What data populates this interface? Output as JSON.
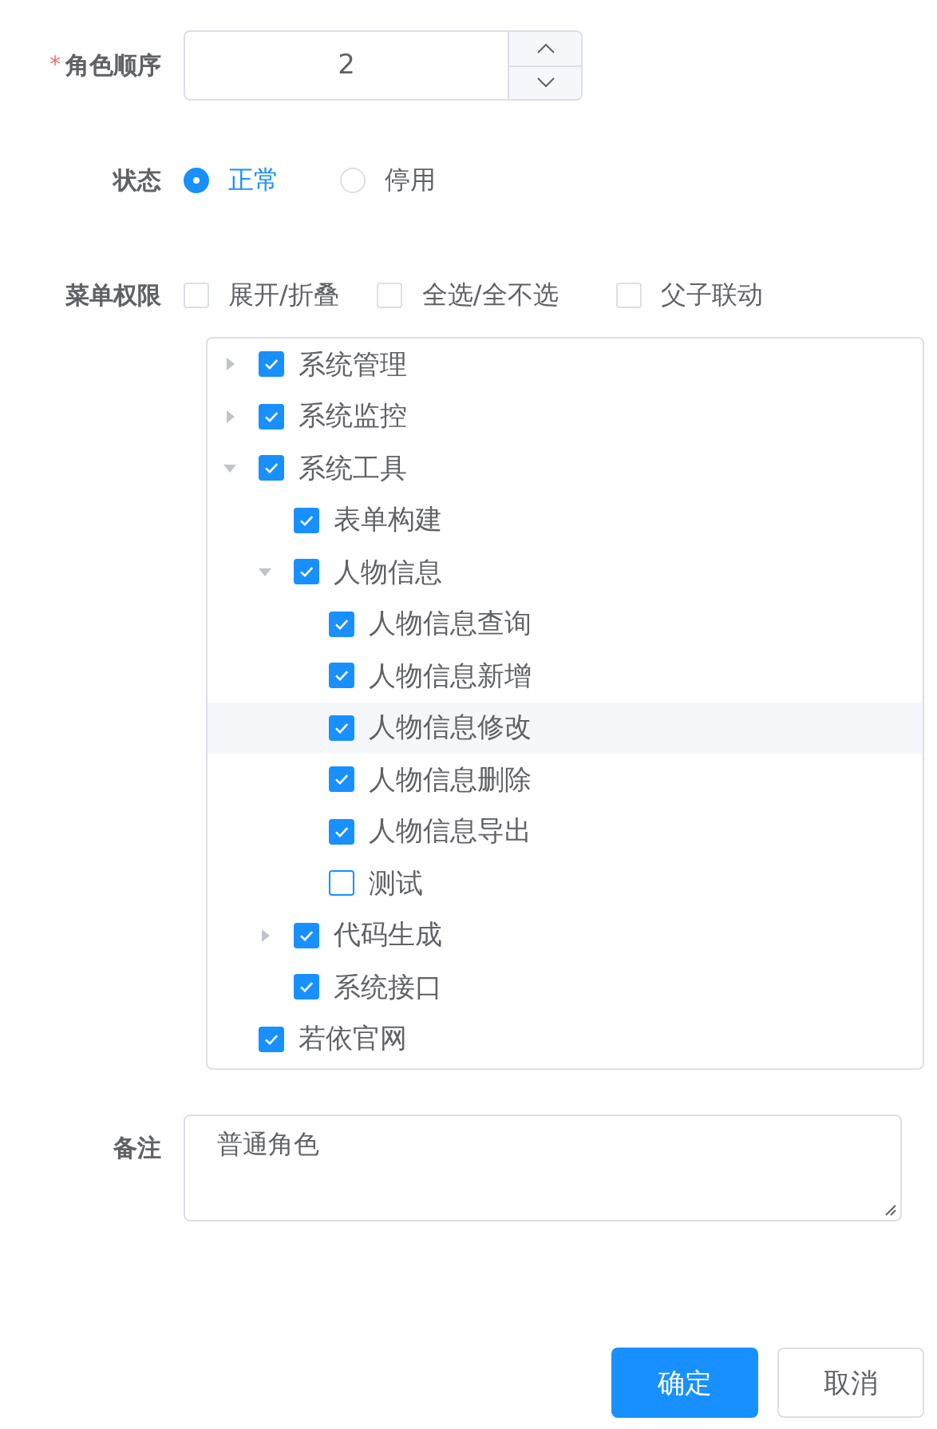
{
  "order": {
    "label": "角色顺序",
    "required_mark": "*",
    "value": "2"
  },
  "status": {
    "label": "状态",
    "options": [
      {
        "label": "正常",
        "selected": true
      },
      {
        "label": "停用",
        "selected": false
      }
    ]
  },
  "menu_permissions": {
    "label": "菜单权限",
    "options": [
      {
        "label": "展开/折叠",
        "checked": false
      },
      {
        "label": "全选/全不选",
        "checked": false
      },
      {
        "label": "父子联动",
        "checked": false
      }
    ],
    "tree": [
      {
        "label": "系统管理",
        "checked": true,
        "expanded": false,
        "hovered": false
      },
      {
        "label": "系统监控",
        "checked": true,
        "expanded": false,
        "hovered": false
      },
      {
        "label": "系统工具",
        "checked": true,
        "expanded": true,
        "hovered": false,
        "children": [
          {
            "label": "表单构建",
            "checked": true,
            "hovered": false
          },
          {
            "label": "人物信息",
            "checked": true,
            "expanded": true,
            "hovered": false,
            "children": [
              {
                "label": "人物信息查询",
                "checked": true,
                "hovered": false
              },
              {
                "label": "人物信息新增",
                "checked": true,
                "hovered": false
              },
              {
                "label": "人物信息修改",
                "checked": true,
                "hovered": true
              },
              {
                "label": "人物信息删除",
                "checked": true,
                "hovered": false
              },
              {
                "label": "人物信息导出",
                "checked": true,
                "hovered": false
              },
              {
                "label": "测试",
                "checked": false,
                "hovered": false
              }
            ]
          },
          {
            "label": "代码生成",
            "checked": true,
            "expanded": false,
            "hovered": false
          },
          {
            "label": "系统接口",
            "checked": true,
            "hovered": false
          }
        ]
      },
      {
        "label": "若依官网",
        "checked": true,
        "hovered": false
      }
    ]
  },
  "remark": {
    "label": "备注",
    "value": "普通角色"
  },
  "buttons": [
    {
      "label": "确定",
      "kind": "primary"
    },
    {
      "label": "取消",
      "kind": "default"
    }
  ]
}
